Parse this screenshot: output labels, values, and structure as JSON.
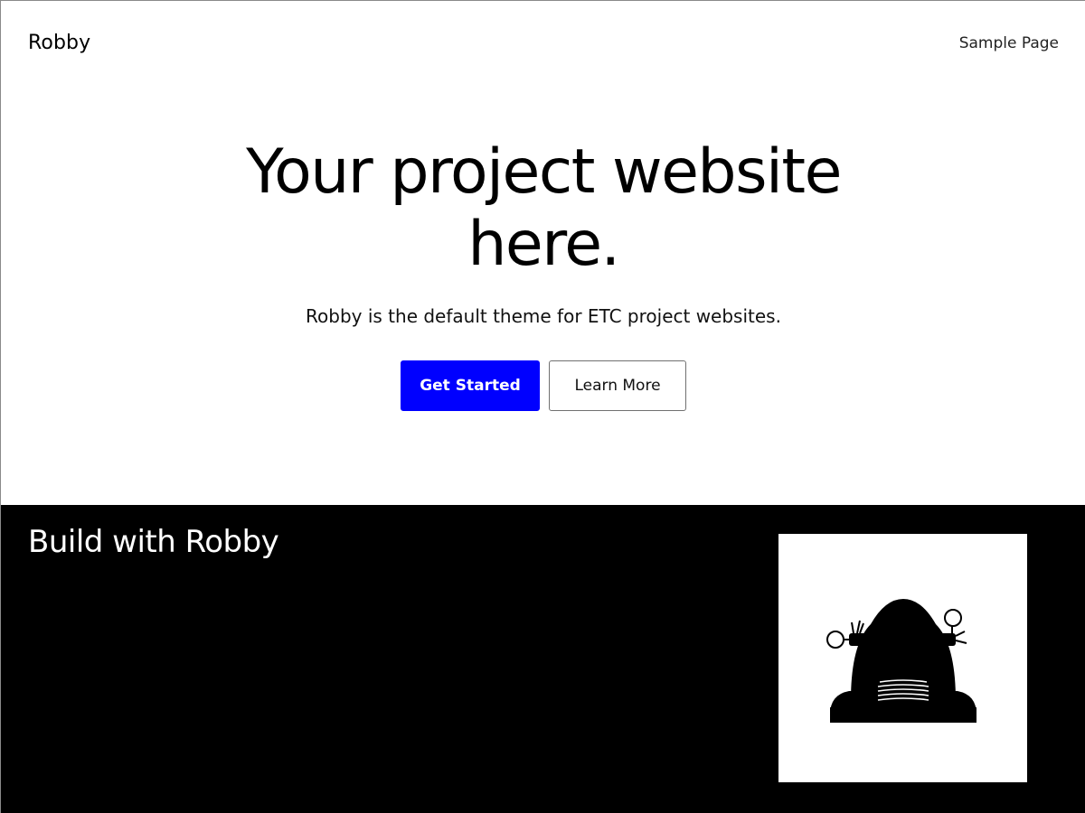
{
  "header": {
    "site_title": "Robby",
    "nav": [
      {
        "label": "Sample Page"
      }
    ]
  },
  "hero": {
    "title": "Your project website here.",
    "subtitle": "Robby is the default theme for ETC project websites.",
    "primary_button": "Get Started",
    "secondary_button": "Learn More"
  },
  "feature": {
    "heading": "Build with Robby",
    "image_icon": "robot-icon"
  },
  "colors": {
    "accent": "#0000ff",
    "dark_section": "#000000",
    "page_background": "#ffffff"
  }
}
